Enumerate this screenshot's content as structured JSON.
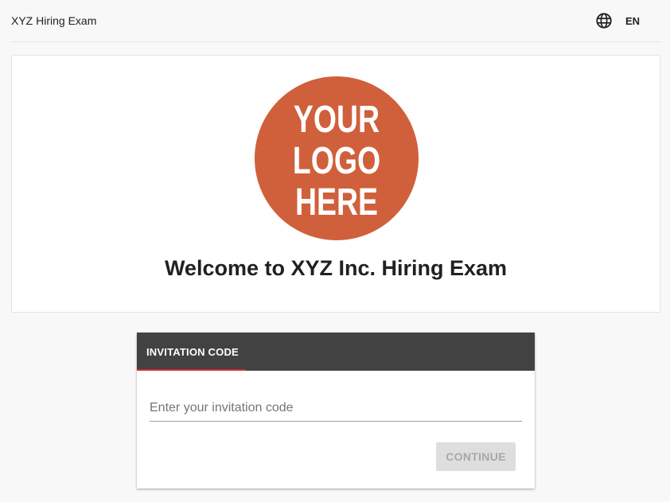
{
  "header": {
    "app_title": "XYZ Hiring Exam",
    "language_icon": "globe-icon",
    "language_code": "EN"
  },
  "hero": {
    "logo": {
      "lines": [
        "YOUR",
        "LOGO",
        "HERE"
      ],
      "circle_color": "#d0603b",
      "text_color": "#ffffff"
    },
    "welcome_text": "Welcome to XYZ Inc. Hiring Exam"
  },
  "invitation_card": {
    "tab_label": "INVITATION CODE",
    "tab_header_color": "#424242",
    "tab_indicator_color": "#d32f2f",
    "code_input": {
      "value": "",
      "placeholder": "Enter your invitation code"
    },
    "continue_label": "CONTINUE",
    "continue_disabled": true
  }
}
